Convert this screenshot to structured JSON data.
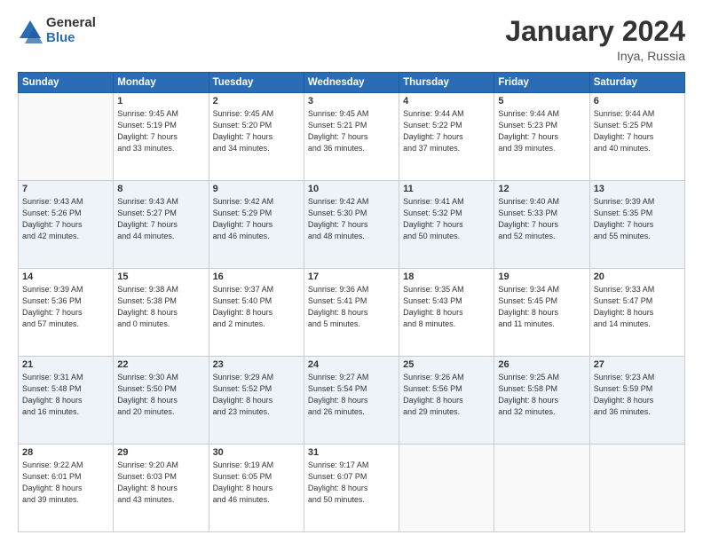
{
  "logo": {
    "general": "General",
    "blue": "Blue"
  },
  "title": "January 2024",
  "location": "Inya, Russia",
  "days_of_week": [
    "Sunday",
    "Monday",
    "Tuesday",
    "Wednesday",
    "Thursday",
    "Friday",
    "Saturday"
  ],
  "weeks": [
    [
      {
        "day": "",
        "info": ""
      },
      {
        "day": "1",
        "info": "Sunrise: 9:45 AM\nSunset: 5:19 PM\nDaylight: 7 hours\nand 33 minutes."
      },
      {
        "day": "2",
        "info": "Sunrise: 9:45 AM\nSunset: 5:20 PM\nDaylight: 7 hours\nand 34 minutes."
      },
      {
        "day": "3",
        "info": "Sunrise: 9:45 AM\nSunset: 5:21 PM\nDaylight: 7 hours\nand 36 minutes."
      },
      {
        "day": "4",
        "info": "Sunrise: 9:44 AM\nSunset: 5:22 PM\nDaylight: 7 hours\nand 37 minutes."
      },
      {
        "day": "5",
        "info": "Sunrise: 9:44 AM\nSunset: 5:23 PM\nDaylight: 7 hours\nand 39 minutes."
      },
      {
        "day": "6",
        "info": "Sunrise: 9:44 AM\nSunset: 5:25 PM\nDaylight: 7 hours\nand 40 minutes."
      }
    ],
    [
      {
        "day": "7",
        "info": "Sunrise: 9:43 AM\nSunset: 5:26 PM\nDaylight: 7 hours\nand 42 minutes."
      },
      {
        "day": "8",
        "info": "Sunrise: 9:43 AM\nSunset: 5:27 PM\nDaylight: 7 hours\nand 44 minutes."
      },
      {
        "day": "9",
        "info": "Sunrise: 9:42 AM\nSunset: 5:29 PM\nDaylight: 7 hours\nand 46 minutes."
      },
      {
        "day": "10",
        "info": "Sunrise: 9:42 AM\nSunset: 5:30 PM\nDaylight: 7 hours\nand 48 minutes."
      },
      {
        "day": "11",
        "info": "Sunrise: 9:41 AM\nSunset: 5:32 PM\nDaylight: 7 hours\nand 50 minutes."
      },
      {
        "day": "12",
        "info": "Sunrise: 9:40 AM\nSunset: 5:33 PM\nDaylight: 7 hours\nand 52 minutes."
      },
      {
        "day": "13",
        "info": "Sunrise: 9:39 AM\nSunset: 5:35 PM\nDaylight: 7 hours\nand 55 minutes."
      }
    ],
    [
      {
        "day": "14",
        "info": "Sunrise: 9:39 AM\nSunset: 5:36 PM\nDaylight: 7 hours\nand 57 minutes."
      },
      {
        "day": "15",
        "info": "Sunrise: 9:38 AM\nSunset: 5:38 PM\nDaylight: 8 hours\nand 0 minutes."
      },
      {
        "day": "16",
        "info": "Sunrise: 9:37 AM\nSunset: 5:40 PM\nDaylight: 8 hours\nand 2 minutes."
      },
      {
        "day": "17",
        "info": "Sunrise: 9:36 AM\nSunset: 5:41 PM\nDaylight: 8 hours\nand 5 minutes."
      },
      {
        "day": "18",
        "info": "Sunrise: 9:35 AM\nSunset: 5:43 PM\nDaylight: 8 hours\nand 8 minutes."
      },
      {
        "day": "19",
        "info": "Sunrise: 9:34 AM\nSunset: 5:45 PM\nDaylight: 8 hours\nand 11 minutes."
      },
      {
        "day": "20",
        "info": "Sunrise: 9:33 AM\nSunset: 5:47 PM\nDaylight: 8 hours\nand 14 minutes."
      }
    ],
    [
      {
        "day": "21",
        "info": "Sunrise: 9:31 AM\nSunset: 5:48 PM\nDaylight: 8 hours\nand 16 minutes."
      },
      {
        "day": "22",
        "info": "Sunrise: 9:30 AM\nSunset: 5:50 PM\nDaylight: 8 hours\nand 20 minutes."
      },
      {
        "day": "23",
        "info": "Sunrise: 9:29 AM\nSunset: 5:52 PM\nDaylight: 8 hours\nand 23 minutes."
      },
      {
        "day": "24",
        "info": "Sunrise: 9:27 AM\nSunset: 5:54 PM\nDaylight: 8 hours\nand 26 minutes."
      },
      {
        "day": "25",
        "info": "Sunrise: 9:26 AM\nSunset: 5:56 PM\nDaylight: 8 hours\nand 29 minutes."
      },
      {
        "day": "26",
        "info": "Sunrise: 9:25 AM\nSunset: 5:58 PM\nDaylight: 8 hours\nand 32 minutes."
      },
      {
        "day": "27",
        "info": "Sunrise: 9:23 AM\nSunset: 5:59 PM\nDaylight: 8 hours\nand 36 minutes."
      }
    ],
    [
      {
        "day": "28",
        "info": "Sunrise: 9:22 AM\nSunset: 6:01 PM\nDaylight: 8 hours\nand 39 minutes."
      },
      {
        "day": "29",
        "info": "Sunrise: 9:20 AM\nSunset: 6:03 PM\nDaylight: 8 hours\nand 43 minutes."
      },
      {
        "day": "30",
        "info": "Sunrise: 9:19 AM\nSunset: 6:05 PM\nDaylight: 8 hours\nand 46 minutes."
      },
      {
        "day": "31",
        "info": "Sunrise: 9:17 AM\nSunset: 6:07 PM\nDaylight: 8 hours\nand 50 minutes."
      },
      {
        "day": "",
        "info": ""
      },
      {
        "day": "",
        "info": ""
      },
      {
        "day": "",
        "info": ""
      }
    ]
  ]
}
